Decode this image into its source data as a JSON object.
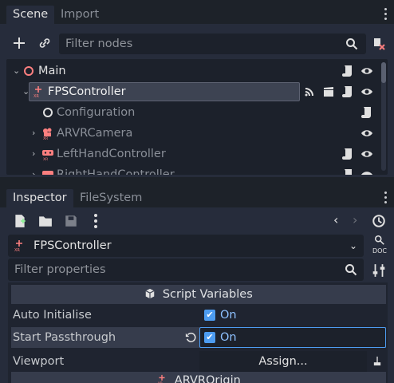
{
  "scene_panel": {
    "tabs": [
      {
        "label": "Scene"
      },
      {
        "label": "Import"
      }
    ],
    "filter_placeholder": "Filter nodes",
    "tree": [
      {
        "label": "Main",
        "icon": "circle-outline-red-icon",
        "expand": "⌄",
        "actions": [
          "script-icon",
          "visibility-icon"
        ]
      },
      {
        "label": "FPSController",
        "icon": "xr-origin-icon",
        "expand": "⌄",
        "selected": true,
        "actions": [
          "signal-icon",
          "clapper-icon",
          "script-icon",
          "visibility-icon"
        ]
      },
      {
        "label": "Configuration",
        "icon": "circle-outline-white-icon",
        "expand": "",
        "actions": [
          "script-icon"
        ]
      },
      {
        "label": "ARVRCamera",
        "icon": "xr-camera-icon",
        "expand": "›",
        "actions": [
          "visibility-icon"
        ]
      },
      {
        "label": "LeftHandController",
        "icon": "xr-controller-icon",
        "expand": "›",
        "actions": [
          "script-icon",
          "visibility-icon"
        ]
      },
      {
        "label": "RightHandController",
        "icon": "xr-controller-icon",
        "expand": "›",
        "actions": [
          "script-icon",
          "visibility-icon"
        ]
      }
    ]
  },
  "inspector_panel": {
    "tabs": [
      {
        "label": "Inspector"
      },
      {
        "label": "FileSystem"
      }
    ],
    "object_name": "FPSController",
    "doc_label": "DOC",
    "filter_placeholder": "Filter properties",
    "section_script_vars": "Script Variables",
    "properties": [
      {
        "name": "Auto Initialise",
        "value": "On",
        "checked": true
      },
      {
        "name": "Start Passthrough",
        "value": "On",
        "checked": true,
        "revert": true
      },
      {
        "name": "Viewport",
        "value": "Assign..."
      }
    ],
    "section_origin": "ARVROrigin"
  },
  "colors": {
    "accent": "#4d9cf0",
    "node_red": "#fc7f7f",
    "background": "#262c3b"
  }
}
